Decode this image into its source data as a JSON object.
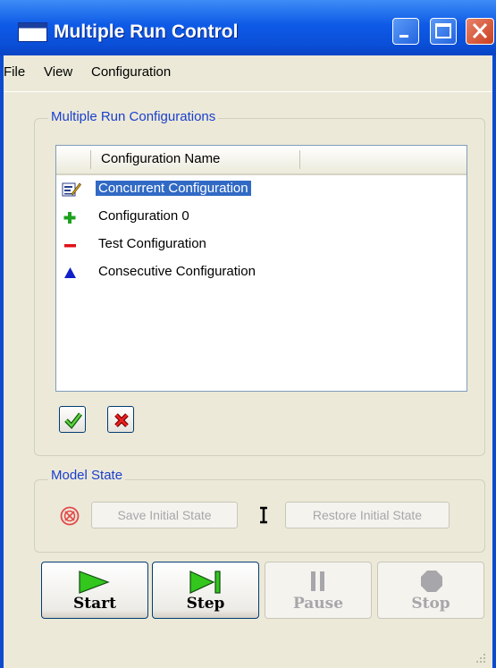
{
  "window": {
    "title": "Multiple Run Control"
  },
  "menu": [
    "File",
    "View",
    "Configuration"
  ],
  "configurations_group": {
    "legend": "Multiple Run Configurations",
    "column_header": "Configuration Name",
    "items": [
      {
        "label": "Concurrent Configuration",
        "icon": "edit-icon",
        "selected": true
      },
      {
        "label": "Configuration 0",
        "icon": "plus-icon",
        "selected": false
      },
      {
        "label": "Test Configuration",
        "icon": "minus-icon",
        "selected": false
      },
      {
        "label": "Consecutive Configuration",
        "icon": "triangle-icon",
        "selected": false
      }
    ]
  },
  "model_state_group": {
    "legend": "Model State",
    "save_label": "Save Initial State",
    "restore_label": "Restore Initial State"
  },
  "controls": {
    "start": "Start",
    "step": "Step",
    "pause": "Pause",
    "stop": "Stop"
  },
  "colors": {
    "titlebar": "#0a4fd8",
    "selection": "#316ac5",
    "accent_green": "#1ea11e",
    "accent_red": "#e0101a",
    "accent_blue": "#1020c8",
    "legend_text": "#1a3fce"
  }
}
